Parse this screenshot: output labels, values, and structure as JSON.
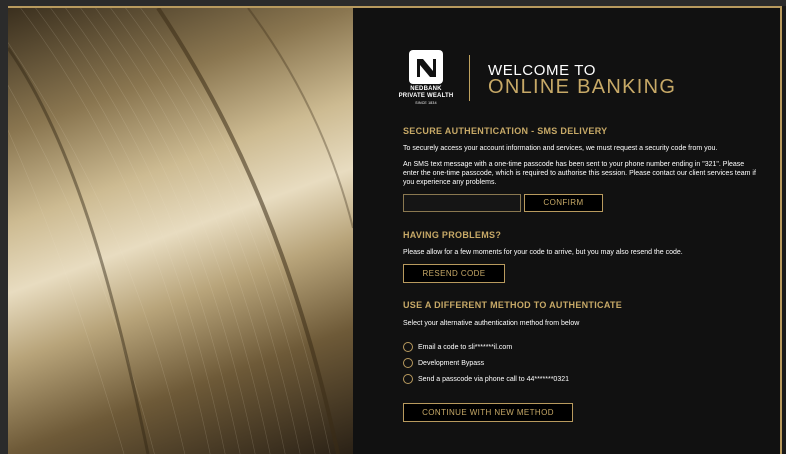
{
  "brand": {
    "name": "NEDBANK",
    "sub": "PRIVATE WEALTH",
    "since": "SINCE 1834"
  },
  "welcome": {
    "line1": "WELCOME TO",
    "line2": "ONLINE BANKING"
  },
  "sms": {
    "heading": "SECURE AUTHENTICATION - SMS DELIVERY",
    "intro": "To securely access your account information and services, we must request a security code from you.",
    "body": "An SMS text message with a one-time passcode has been sent to your phone number ending in \"321\". Please enter the one-time passcode, which is required to authorise this session. Please contact our client services team if you experience any problems.",
    "code_value": "",
    "confirm_label": "CONFIRM"
  },
  "problems": {
    "heading": "HAVING PROBLEMS?",
    "body": "Please allow for a few moments for your code to arrive, but you may also resend the code.",
    "resend_label": "RESEND CODE"
  },
  "methods": {
    "heading": "USE A DIFFERENT METHOD TO AUTHENTICATE",
    "intro": "Select your alternative authentication method from below",
    "options": [
      {
        "label": "Email a code to sli*******il.com"
      },
      {
        "label": "Development Bypass"
      },
      {
        "label": "Send a passcode via phone call to 44*******0321"
      }
    ],
    "continue_label": "CONTINUE WITH NEW METHOD"
  },
  "colors": {
    "accent": "#c7a967",
    "panel": "#111111",
    "text": "#ffffff"
  }
}
